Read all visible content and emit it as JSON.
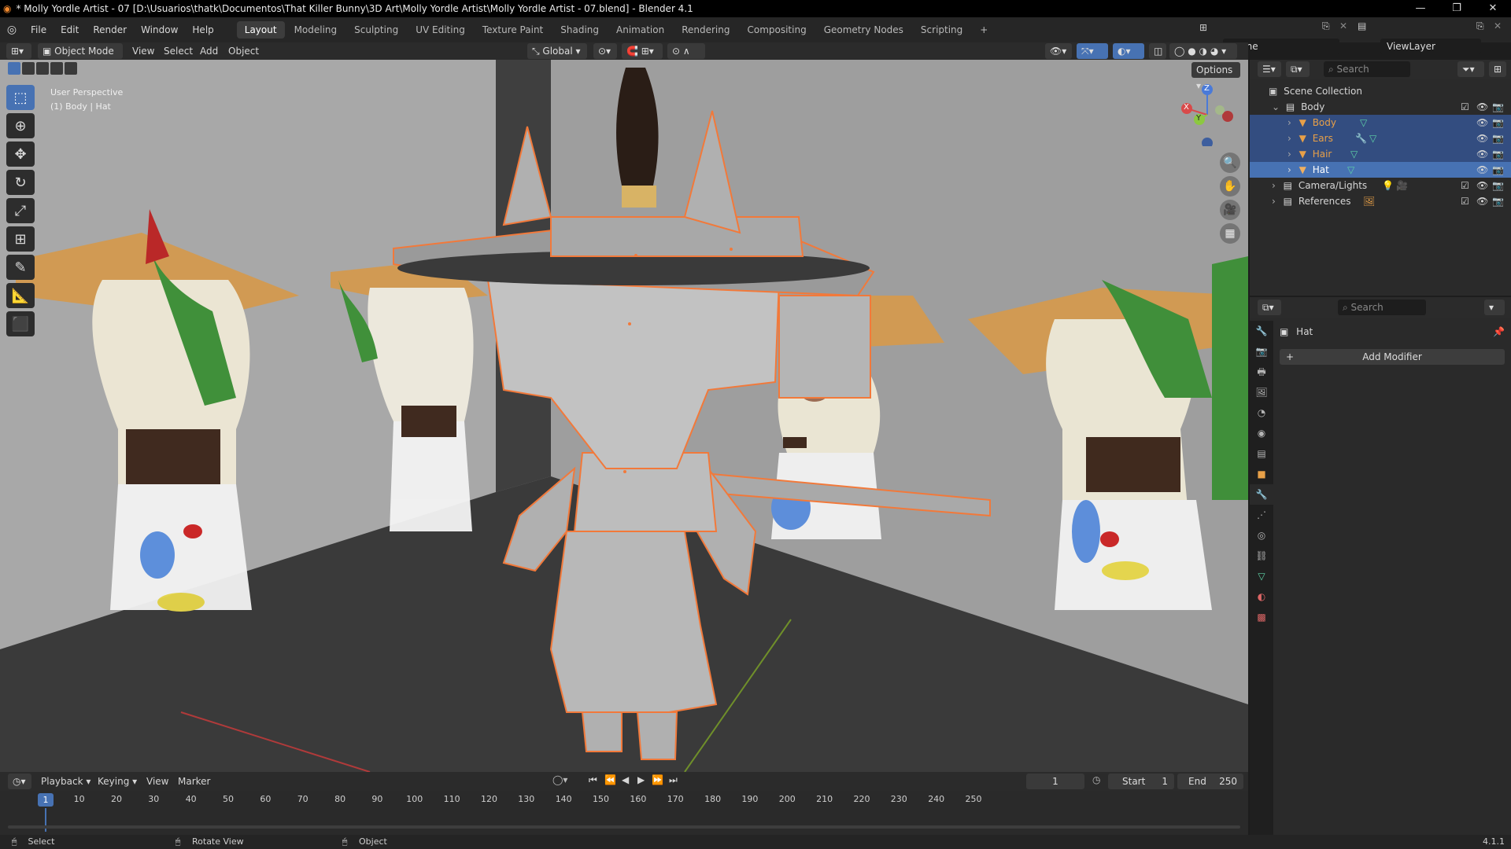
{
  "window": {
    "title": "* Molly Yordle Artist - 07 [D:\\Usuarios\\thatk\\Documentos\\That Killer Bunny\\3D Art\\Molly Yordle Artist\\Molly Yordle Artist - 07.blend] - Blender 4.1"
  },
  "menus": [
    "File",
    "Edit",
    "Render",
    "Window",
    "Help"
  ],
  "workspaces": [
    "Layout",
    "Modeling",
    "Sculpting",
    "UV Editing",
    "Texture Paint",
    "Shading",
    "Animation",
    "Rendering",
    "Compositing",
    "Geometry Nodes",
    "Scripting"
  ],
  "active_workspace": "Layout",
  "scene": {
    "scene_name": "Scene",
    "view_layer": "ViewLayer"
  },
  "viewport_header": {
    "mode": "Object Mode",
    "menus": [
      "View",
      "Select",
      "Add",
      "Object"
    ],
    "orientation": "Global",
    "options": "Options"
  },
  "viewport": {
    "perspective_label": "User Perspective",
    "object_label": "(1) Body | Hat",
    "gizmo": {
      "z": "Z",
      "x": "X",
      "y": "Y"
    },
    "tools": [
      "select-box",
      "cursor",
      "move",
      "rotate",
      "scale",
      "transform",
      "annotate",
      "measure",
      "add-cube"
    ]
  },
  "outliner": {
    "search_placeholder": "Search",
    "root": "Scene Collection",
    "items": [
      {
        "name": "Body",
        "level": 1,
        "type": "collection"
      },
      {
        "name": "Body",
        "level": 2,
        "type": "object",
        "state": "selected"
      },
      {
        "name": "Ears",
        "level": 2,
        "type": "object",
        "state": "selected"
      },
      {
        "name": "Hair",
        "level": 2,
        "type": "object",
        "state": "selected"
      },
      {
        "name": "Hat",
        "level": 2,
        "type": "object",
        "state": "active"
      },
      {
        "name": "Camera/Lights",
        "level": 1,
        "type": "collection"
      },
      {
        "name": "References",
        "level": 1,
        "type": "collection"
      }
    ]
  },
  "properties": {
    "search_placeholder": "Search",
    "object_name": "Hat",
    "add_modifier": "Add Modifier"
  },
  "timeline": {
    "menus": [
      "Playback",
      "Keying",
      "View",
      "Marker"
    ],
    "current_frame": "1",
    "start_label": "Start",
    "start": "1",
    "end_label": "End",
    "end": "250",
    "ruler": [
      "1",
      "10",
      "20",
      "30",
      "40",
      "50",
      "60",
      "70",
      "80",
      "90",
      "100",
      "110",
      "120",
      "130",
      "140",
      "150",
      "160",
      "170",
      "180",
      "190",
      "200",
      "210",
      "220",
      "230",
      "240",
      "250"
    ]
  },
  "statusbar": {
    "select": "Select",
    "rotate": "Rotate View",
    "object": "Object",
    "version": "4.1.1"
  },
  "colors": {
    "accent": "#4772b3",
    "selected_outline": "#f2793a",
    "object_orange": "#e8a048",
    "mesh_green": "#5fd4a7"
  }
}
